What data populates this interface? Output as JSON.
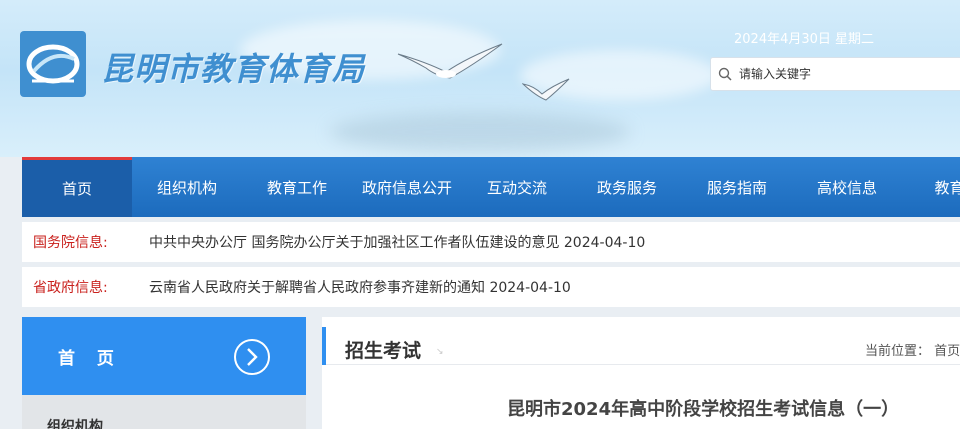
{
  "header": {
    "site_title": "昆明市教育体育局",
    "date": "2024年4月30日 星期二",
    "search": {
      "placeholder": "请输入关键字"
    }
  },
  "nav": {
    "items": [
      {
        "label": "首页",
        "active": true
      },
      {
        "label": "组织机构"
      },
      {
        "label": "教育工作"
      },
      {
        "label": "政府信息公开"
      },
      {
        "label": "互动交流"
      },
      {
        "label": "政务服务"
      },
      {
        "label": "服务指南"
      },
      {
        "label": "高校信息"
      },
      {
        "label": "教育电"
      }
    ]
  },
  "notices": [
    {
      "label": "国务院信息:",
      "text": "中共中央办公厅 国务院办公厅关于加强社区工作者队伍建设的意见 2024-04-10"
    },
    {
      "label": "省政府信息:",
      "text": "云南省人民政府关于解聘省人民政府参事齐建新的通知 2024-04-10"
    }
  ],
  "sidebar": {
    "home_label": "首 页",
    "items": [
      {
        "label": "组织机构"
      }
    ]
  },
  "main": {
    "section_title": "招生考试",
    "breadcrumb": "当前位置： 首页",
    "article_title": "昆明市2024年高中阶段学校招生考试信息（一）"
  },
  "colors": {
    "nav_blue": "#1c6bbd",
    "active_nav": "#1b5ea9",
    "notice_red": "#c9201c",
    "sidebar_blue": "#2f8ff0"
  },
  "icons": [
    "logo-emblem",
    "search-icon",
    "chevron-right-icon",
    "seagull-icon"
  ]
}
